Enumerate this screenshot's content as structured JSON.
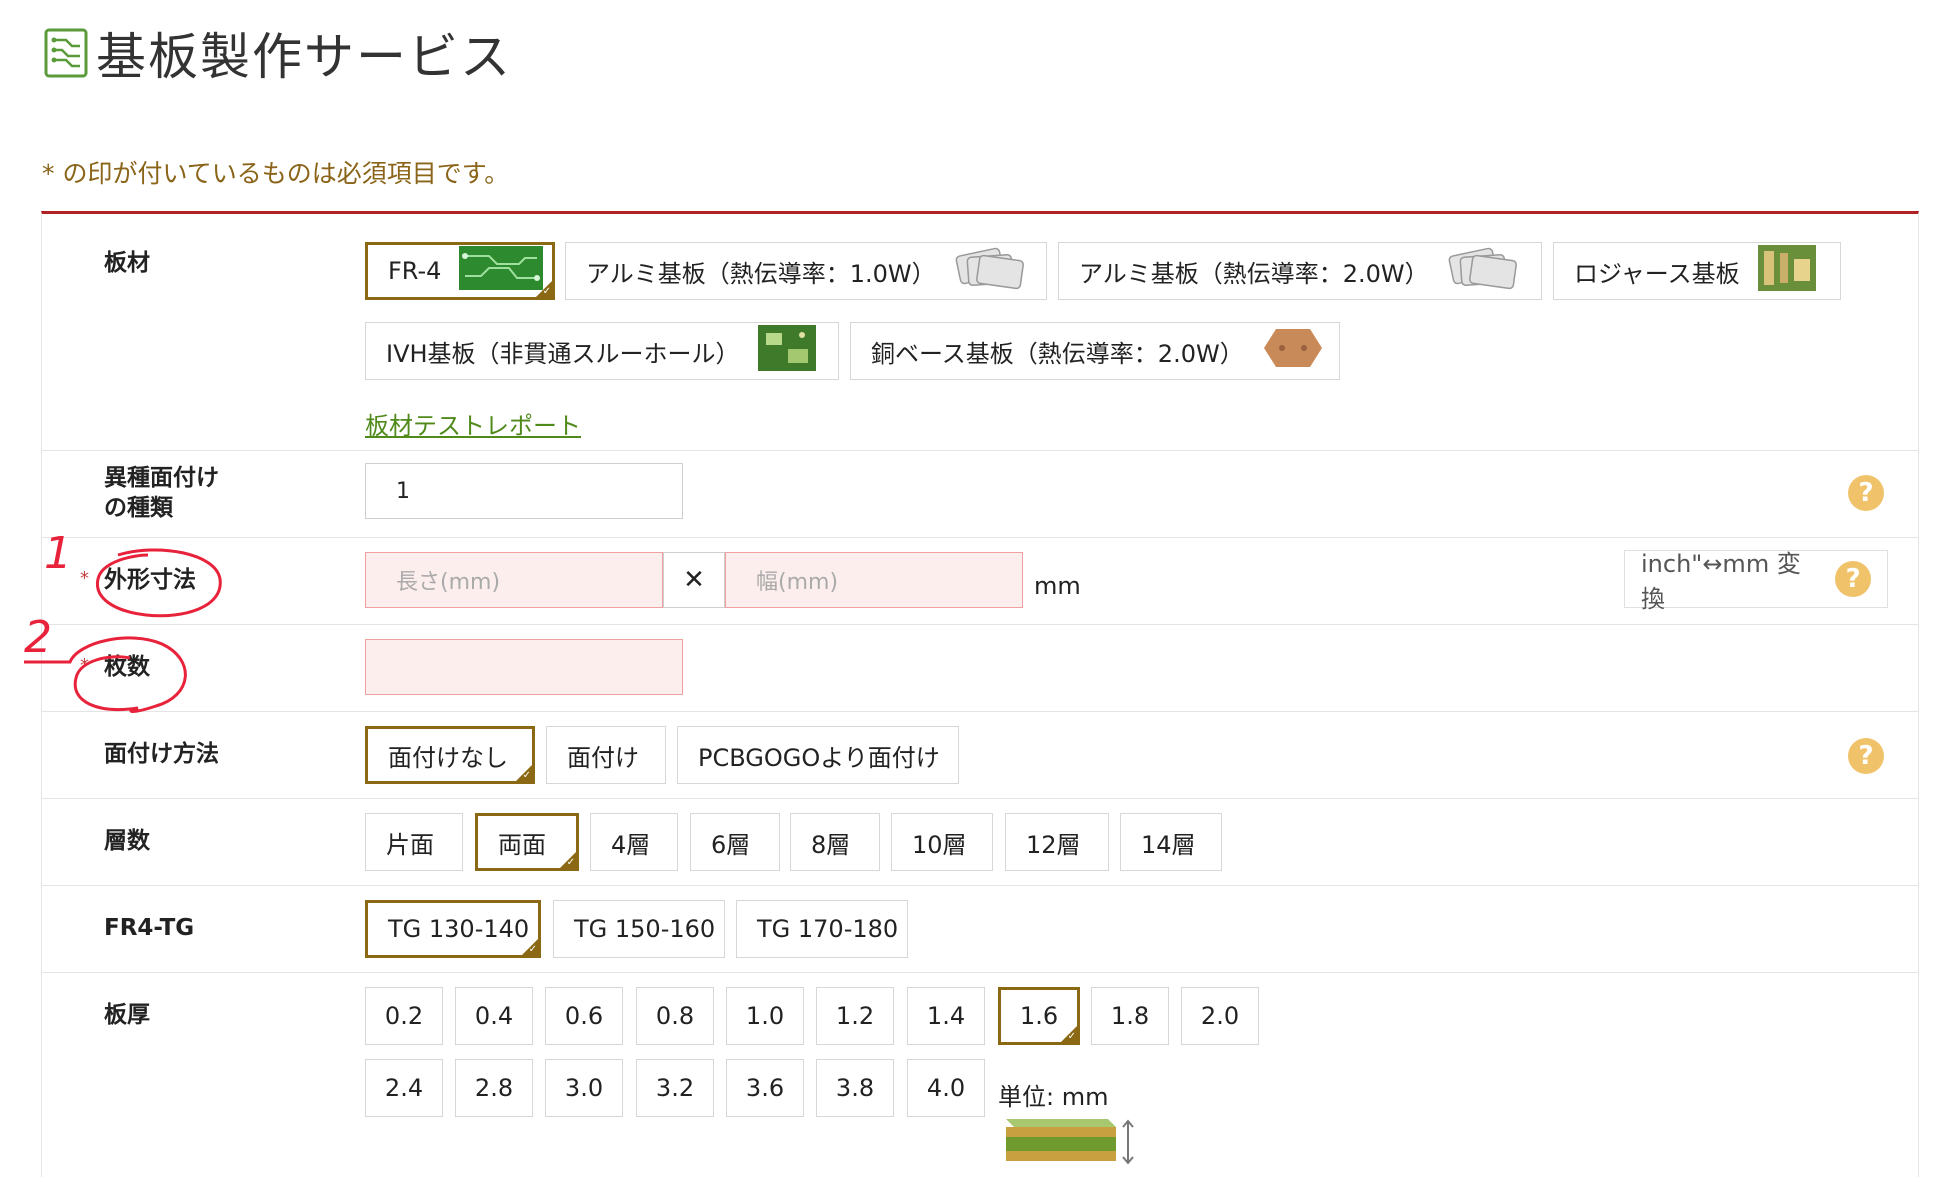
{
  "page": {
    "title": "基板製作サービス",
    "required_note": "* の印が付いているものは必須項目です。"
  },
  "material": {
    "label": "板材",
    "options": [
      {
        "label": "FR-4",
        "selected": true
      },
      {
        "label": "アルミ基板（熱伝導率：1.0W）",
        "selected": false
      },
      {
        "label": "アルミ基板（熱伝導率：2.0W）",
        "selected": false
      },
      {
        "label": "ロジャース基板",
        "selected": false
      },
      {
        "label": "IVH基板（非貫通スルーホール）",
        "selected": false
      },
      {
        "label": "銅ベース基板（熱伝導率：2.0W）",
        "selected": false
      }
    ],
    "test_report_link": "板材テストレポート"
  },
  "design_count": {
    "label_line1": "異種面付け",
    "label_line2": "の種類",
    "value": "1"
  },
  "dimensions": {
    "required_mark": "*",
    "label": "外形寸法",
    "length_placeholder": "長さ(mm)",
    "width_placeholder": "幅(mm)",
    "times": "✕",
    "unit": "mm",
    "convert_button": "inch\"↔mm 変換"
  },
  "quantity": {
    "required_mark": "*",
    "label": "枚数",
    "value": ""
  },
  "panelize": {
    "label": "面付け方法",
    "options": [
      {
        "label": "面付けなし",
        "selected": true
      },
      {
        "label": "面付け",
        "selected": false
      },
      {
        "label": "PCBGOGOより面付け",
        "selected": false
      }
    ]
  },
  "layers": {
    "label": "層数",
    "options": [
      {
        "label": "片面",
        "selected": false
      },
      {
        "label": "両面",
        "selected": true
      },
      {
        "label": "4層",
        "selected": false
      },
      {
        "label": "6層",
        "selected": false
      },
      {
        "label": "8層",
        "selected": false
      },
      {
        "label": "10層",
        "selected": false
      },
      {
        "label": "12層",
        "selected": false
      },
      {
        "label": "14層",
        "selected": false
      }
    ]
  },
  "tg": {
    "label": "FR4-TG",
    "options": [
      {
        "label": "TG 130-140",
        "selected": true
      },
      {
        "label": "TG 150-160",
        "selected": false
      },
      {
        "label": "TG 170-180",
        "selected": false
      }
    ]
  },
  "thickness": {
    "label": "板厚",
    "row1": [
      "0.2",
      "0.4",
      "0.6",
      "0.8",
      "1.0",
      "1.2",
      "1.4",
      "1.6",
      "1.8",
      "2.0"
    ],
    "row2": [
      "2.4",
      "2.8",
      "3.0",
      "3.2",
      "3.6",
      "3.8",
      "4.0"
    ],
    "selected": "1.6",
    "unit_label": "単位: mm"
  },
  "help_mark": "?",
  "annotations": {
    "mark1": "1",
    "mark2": "2"
  },
  "colors": {
    "accent": "#8b6914",
    "required_note": "#8a6418",
    "top_border": "#b22222",
    "link": "#4f8a1b",
    "help": "#f0c36a",
    "annotation": "#e8223a",
    "error_bg": "#fdeeee"
  }
}
